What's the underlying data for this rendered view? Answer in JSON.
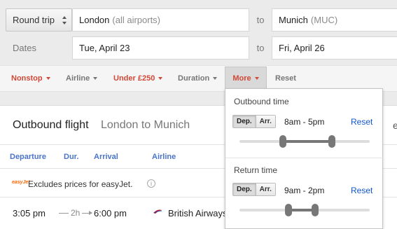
{
  "search": {
    "trip_type": "Round trip",
    "origin": "London",
    "origin_detail": "(all airports)",
    "to_label": "to",
    "destination": "Munich",
    "destination_detail": "(MUC)",
    "dates_label": "Dates",
    "depart_date": "Tue, April 23",
    "return_date": "Fri, April 26"
  },
  "filters": {
    "nonstop": "Nonstop",
    "airline": "Airline",
    "price": "Under £250",
    "duration": "Duration",
    "more": "More",
    "reset": "Reset"
  },
  "results": {
    "title": "Outbound flight",
    "route": "London to Munich",
    "cut_text": "esc",
    "columns": {
      "departure": "Departure",
      "dur": "Dur.",
      "arrival": "Arrival",
      "airline": "Airline"
    },
    "notice": "Excludes prices for easyJet.",
    "notice_logo": "easyJet",
    "flight": {
      "depart": "3:05 pm",
      "duration": "2h",
      "arrive": "6:00 pm",
      "airline": "British Airways"
    }
  },
  "more_dropdown": {
    "outbound": {
      "title": "Outbound time",
      "dep_label": "Dep.",
      "arr_label": "Arr.",
      "range_text": "8am - 5pm",
      "reset": "Reset",
      "range_start_frac": 0.333,
      "range_end_frac": 0.708
    },
    "return": {
      "title": "Return time",
      "dep_label": "Dep.",
      "arr_label": "Arr.",
      "range_text": "9am - 2pm",
      "reset": "Reset",
      "range_start_frac": 0.375,
      "range_end_frac": 0.583
    }
  },
  "colors": {
    "accent_red": "#d14836",
    "link_blue": "#1155cc",
    "column_blue": "#4a74c9"
  }
}
